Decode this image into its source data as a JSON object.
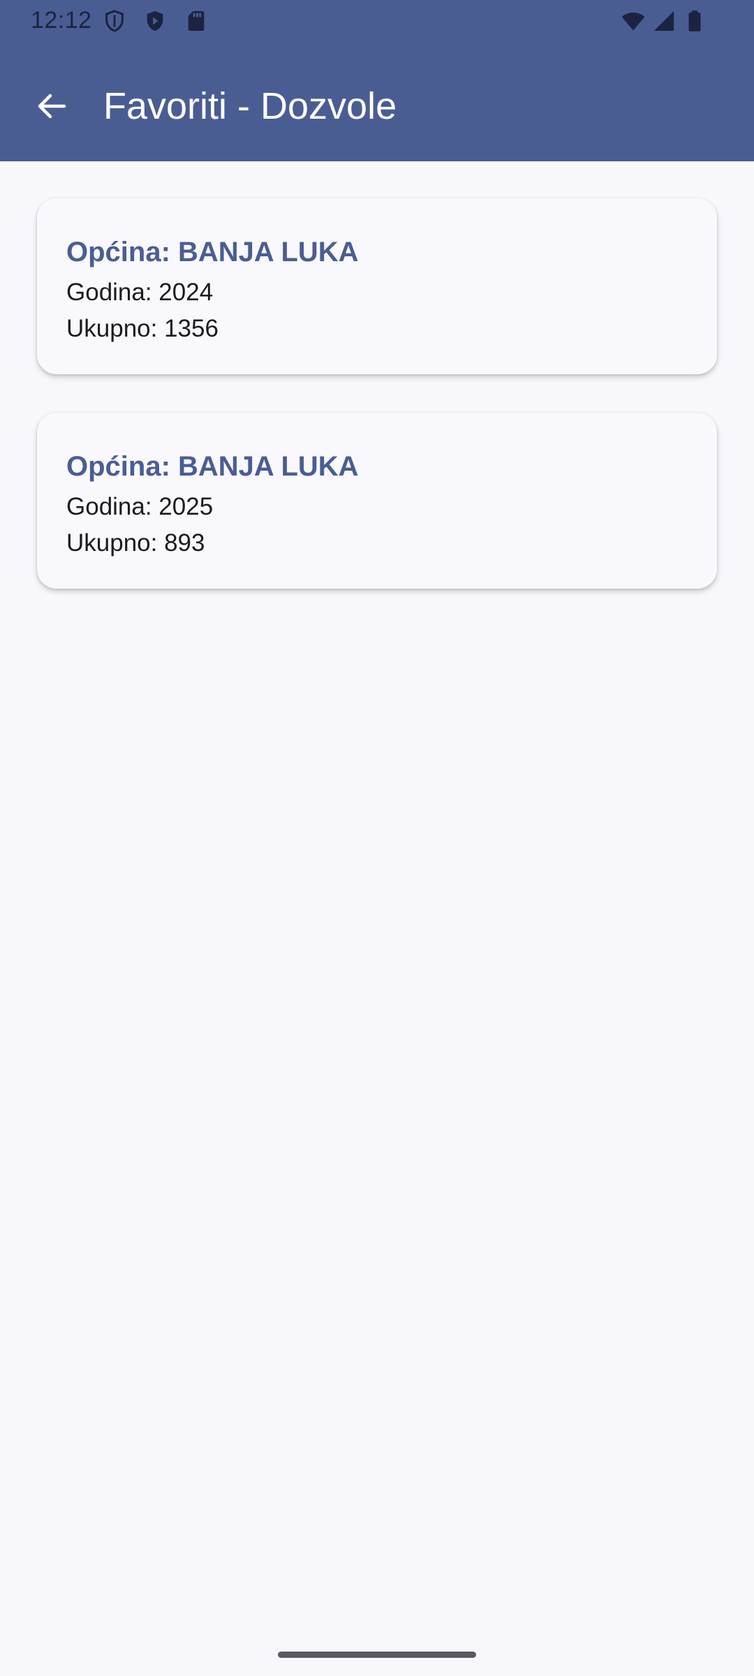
{
  "status_bar": {
    "time": "12:12",
    "left_icons": [
      "shield-outline-icon",
      "shield-filled-icon",
      "sd-card-icon"
    ],
    "right_icons": [
      "wifi-icon",
      "cellular-signal-icon",
      "battery-icon"
    ]
  },
  "app_bar": {
    "title": "Favoriti - Dozvole",
    "back_icon": "arrow-back-icon",
    "background_color": "#4a5d93",
    "title_color": "#ffffff"
  },
  "favorites": [
    {
      "title": "Općina: BANJA LUKA",
      "year": "Godina: 2024",
      "total": "Ukupno: 1356"
    },
    {
      "title": "Općina: BANJA LUKA",
      "year": "Godina: 2025",
      "total": "Ukupno: 893"
    }
  ],
  "colors": {
    "accent": "#4a5d93",
    "background": "#f7f7fc",
    "card_background": "#f9f8fd",
    "text": "#1b1b1f"
  }
}
